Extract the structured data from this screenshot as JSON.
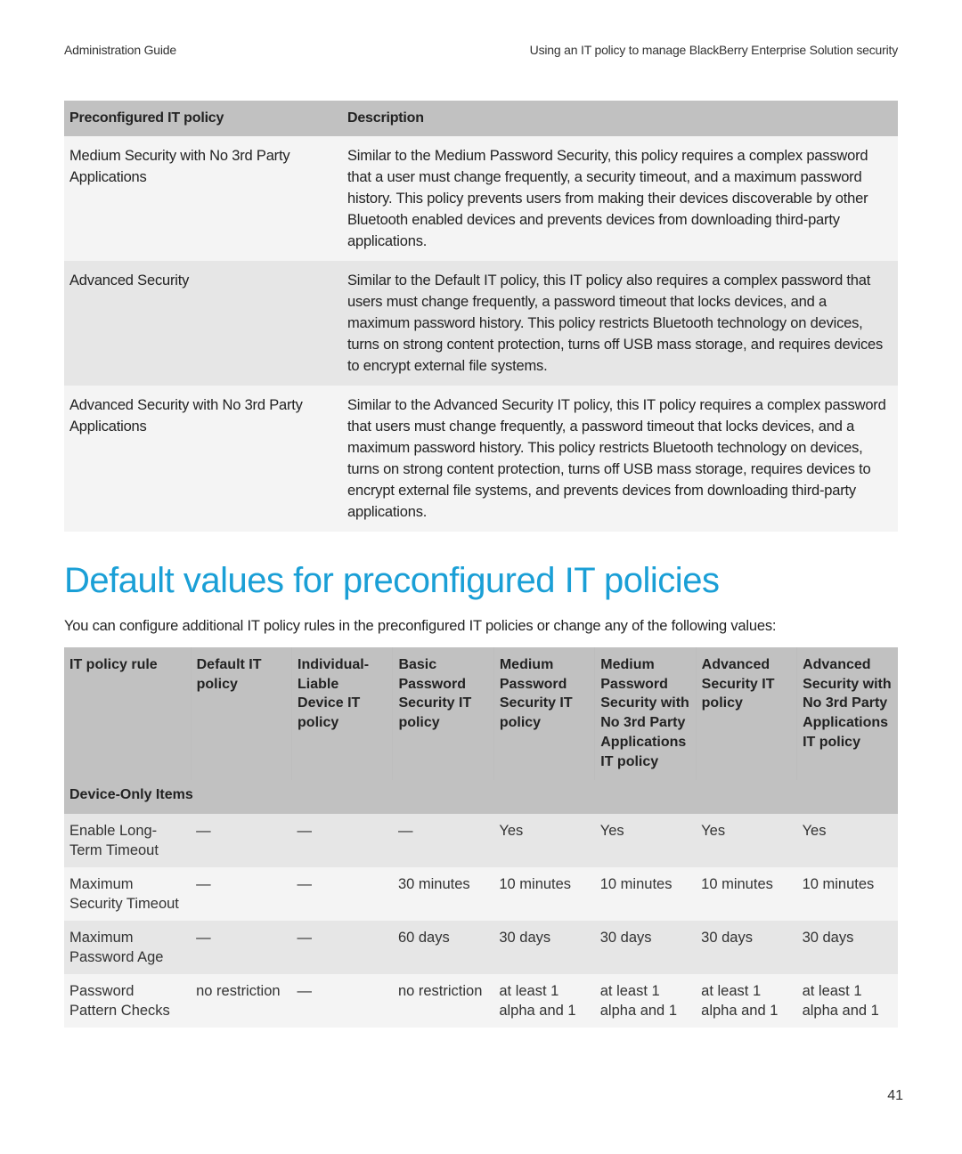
{
  "running_header": {
    "left": "Administration Guide",
    "right": "Using an IT policy to manage BlackBerry Enterprise Solution security"
  },
  "policy_table": {
    "headers": [
      "Preconfigured IT policy",
      "Description"
    ],
    "rows": [
      {
        "policy": "Medium Security with No 3rd Party Applications",
        "description": "Similar to the Medium Password Security, this policy requires a complex password that a user must change frequently, a security timeout, and a maximum password history. This policy prevents users from making their devices discoverable by other Bluetooth enabled devices and prevents devices from downloading third-party applications."
      },
      {
        "policy": "Advanced Security",
        "description": "Similar to the Default IT policy, this IT policy also requires a complex password that users must change frequently, a password timeout that locks devices, and a maximum password history. This policy restricts Bluetooth technology on devices, turns on strong content protection, turns off USB mass storage, and requires devices to encrypt external file systems."
      },
      {
        "policy": "Advanced Security with No 3rd Party Applications",
        "description": "Similar to the Advanced Security IT policy, this IT policy requires a complex password that users must change frequently, a password timeout that locks devices, and a maximum password history. This policy restricts Bluetooth technology on devices, turns on strong content protection, turns off USB mass storage, requires devices to encrypt external file systems, and prevents devices from downloading third-party applications."
      }
    ]
  },
  "section": {
    "title": "Default values for preconfigured IT policies",
    "intro": "You can configure additional IT policy rules in the preconfigured IT policies or change any of the following values:"
  },
  "defaults_table": {
    "headers": [
      "IT policy rule",
      "Default IT policy",
      "Individual-Liable Device IT policy",
      "Basic Password Security IT policy",
      "Medium Password Security IT policy",
      "Medium Password Security with No 3rd Party Applications IT policy",
      "Advanced Security IT policy",
      "Advanced Security with No 3rd Party Applications IT policy"
    ],
    "group_label": "Device-Only Items",
    "rows": [
      {
        "cells": [
          "Enable Long-Term Timeout",
          "—",
          "—",
          "—",
          "Yes",
          "Yes",
          "Yes",
          "Yes"
        ]
      },
      {
        "cells": [
          "Maximum Security Timeout",
          "—",
          "—",
          "30 minutes",
          "10 minutes",
          "10 minutes",
          "10 minutes",
          "10 minutes"
        ]
      },
      {
        "cells": [
          "Maximum Password Age",
          "—",
          "—",
          "60 days",
          "30 days",
          "30 days",
          "30 days",
          "30 days"
        ]
      },
      {
        "cells": [
          "Password Pattern Checks",
          "no restriction",
          "—",
          "no restriction",
          "at least 1 alpha and 1",
          "at least 1 alpha and 1",
          "at least 1 alpha and 1",
          "at least 1 alpha and 1"
        ]
      }
    ]
  },
  "page_number": "41",
  "colors": {
    "heading": "#1a9fd6",
    "table_header_bg": "#c1c1c1",
    "row_dark": "#e6e6e6",
    "row_light": "#f4f4f4"
  }
}
